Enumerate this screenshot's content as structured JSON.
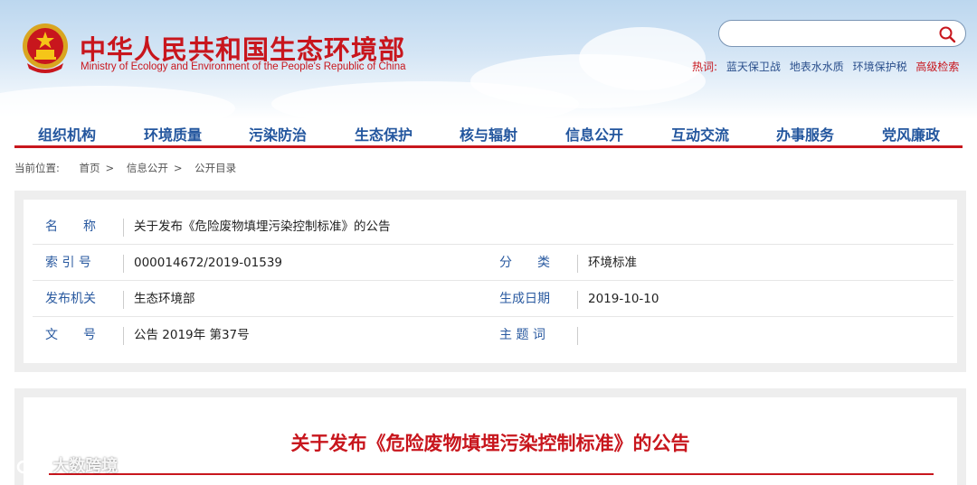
{
  "header": {
    "title": "中华人民共和国生态环境部",
    "subtitle": "Ministry of Ecology and Environment of the People's Republic of China"
  },
  "search": {
    "value": "",
    "placeholder": "",
    "icon": "search-icon"
  },
  "hot": {
    "label": "热词:",
    "links": [
      "蓝天保卫战",
      "地表水水质",
      "环境保护税"
    ],
    "advanced": "高级检索"
  },
  "nav": {
    "items": [
      "组织机构",
      "环境质量",
      "污染防治",
      "生态保护",
      "核与辐射",
      "信息公开",
      "互动交流",
      "办事服务",
      "党风廉政"
    ]
  },
  "breadcrumb": {
    "label": "当前位置:",
    "items": [
      "首页",
      "信息公开",
      "公开目录"
    ],
    "separator": ">"
  },
  "info": {
    "name_label": "名　　称",
    "name_value": "关于发布《危险废物填埋污染控制标准》的公告",
    "index_label": "索 引 号",
    "index_value": "000014672/2019-01539",
    "category_label": "分　　类",
    "category_value": "环境标准",
    "publisher_label": "发布机关",
    "publisher_value": "生态环境部",
    "date_label": "生成日期",
    "date_value": "2019-10-10",
    "docno_label": "文　　号",
    "docno_value": "公告 2019年 第37号",
    "subject_label": "主 题 词",
    "subject_value": ""
  },
  "article": {
    "title": "关于发布《危险废物填埋污染控制标准》的公告"
  },
  "watermark": {
    "text": "大数跨境"
  },
  "colors": {
    "brand_red": "#c8161d",
    "nav_blue": "#23569e",
    "label_blue": "#2a5aa0"
  }
}
